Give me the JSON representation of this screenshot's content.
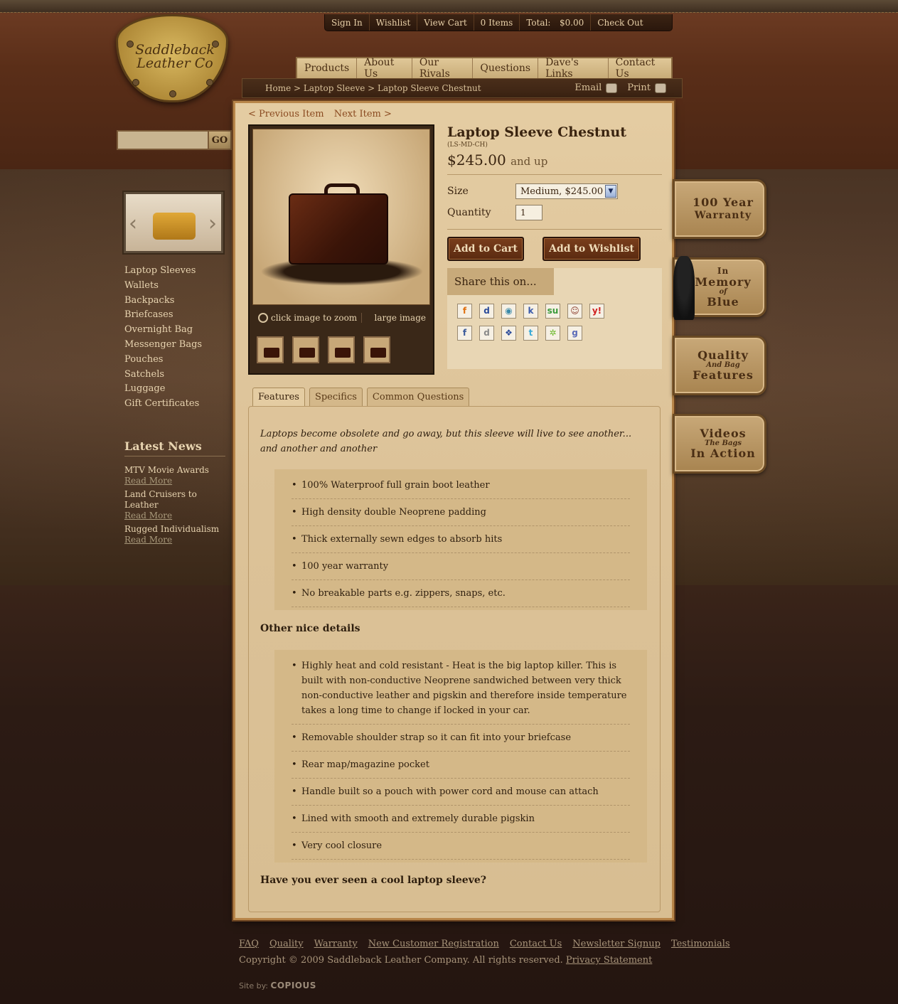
{
  "topbar": {
    "sign_in": "Sign In",
    "wishlist": "Wishlist",
    "view_cart": "View Cart",
    "items": "0 Items",
    "total_label": "Total:",
    "total_value": "$0.00",
    "checkout": "Check Out"
  },
  "logo": {
    "line1": "Saddleback",
    "line2": "Leather Co"
  },
  "search": {
    "button": "GO",
    "placeholder": ""
  },
  "nav": [
    "Products",
    "About Us",
    "Our Rivals",
    "Questions",
    "Dave's Links",
    "Contact Us"
  ],
  "breadcrumb": {
    "text": "Home > Laptop Sleeve > Laptop Sleeve Chestnut"
  },
  "tools": {
    "email": "Email",
    "print": "Print"
  },
  "pager": {
    "prev": "< Previous Item",
    "next": "Next Item >"
  },
  "photo": {
    "zoom": "click image to zoom",
    "large": "large image"
  },
  "product": {
    "title": "Laptop Sleeve Chestnut",
    "sku": "(LS-MD-CH)",
    "price": "$245.00",
    "price_suffix": "and up",
    "size_label": "Size",
    "size_value": "Medium, $245.00",
    "qty_label": "Quantity",
    "qty_value": "1",
    "add_cart": "Add to Cart",
    "add_wishlist": "Add to Wishlist",
    "share": "Share this on..."
  },
  "share_icons": [
    "f",
    "d",
    "◉",
    "k",
    "su",
    "☺",
    "y!",
    "f",
    "d",
    "❖",
    "t",
    "✲",
    "g"
  ],
  "tabs": [
    "Features",
    "Specifics",
    "Common Questions"
  ],
  "features": {
    "intro": "Laptops become obsolete and go away, but this sleeve will live to see another... and another and another",
    "list1": [
      "100% Waterproof full grain boot leather",
      "High density double Neoprene padding",
      "Thick externally sewn edges to absorb hits",
      "100 year warranty",
      "No breakable parts e.g. zippers, snaps, etc."
    ],
    "heading2": "Other nice details",
    "list2": [
      "Highly heat and cold resistant - Heat is the big laptop killer. This is built with non-conductive Neoprene sandwiched between very thick non-conductive leather and pigskin and therefore inside temperature takes a long time to change if locked in your car.",
      "Removable shoulder strap so it can fit into your briefcase",
      "Rear map/magazine pocket",
      "Handle built so a pouch with power cord and mouse can attach",
      "Lined with smooth and extremely durable pigskin",
      "Very cool closure"
    ],
    "heading3": "Have you ever seen a cool laptop sleeve?"
  },
  "sidebar": {
    "categories": [
      "Laptop Sleeves",
      "Wallets",
      "Backpacks",
      "Briefcases",
      "Overnight Bag",
      "Messenger Bags",
      "Pouches",
      "Satchels",
      "Luggage",
      "Gift Certificates"
    ],
    "news_title": "Latest News",
    "news": [
      {
        "title": "MTV Movie Awards",
        "more": "Read More"
      },
      {
        "title": "Land Cruisers to Leather",
        "more": "Read More"
      },
      {
        "title": "Rugged Individualism",
        "more": "Read More"
      }
    ]
  },
  "promos": {
    "warranty": {
      "l1": "100 Year",
      "l2": "Warranty"
    },
    "memory": {
      "l1": "In",
      "l2": "Memory",
      "l3": "of",
      "l4": "Blue"
    },
    "quality": {
      "l1": "Quality",
      "l2": "And Bag",
      "l3": "Features"
    },
    "videos": {
      "l1": "Videos",
      "l2": "The Bags",
      "l3": "In Action"
    }
  },
  "footer": {
    "links": [
      "FAQ",
      "Quality",
      "Warranty",
      "New Customer Registration",
      "Contact Us",
      "Newsletter Signup",
      "Testimonials"
    ],
    "copyright": "Copyright © 2009 Saddleback Leather Company. All rights reserved.",
    "privacy": "Privacy Statement",
    "siteby": "Site by:",
    "agency": "COPIOUS"
  }
}
